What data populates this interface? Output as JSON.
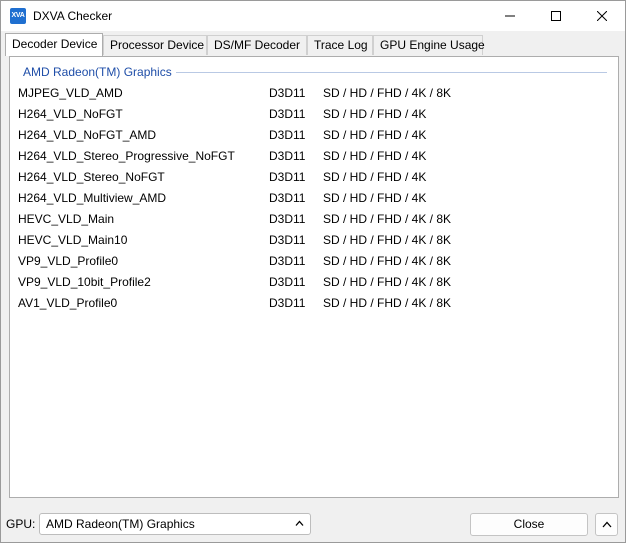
{
  "window": {
    "icon_text": "XVA",
    "title": "DXVA Checker"
  },
  "tabs": [
    {
      "label": "Decoder Device",
      "active": true
    },
    {
      "label": "Processor Device",
      "active": false
    },
    {
      "label": "DS/MF Decoder",
      "active": false
    },
    {
      "label": "Trace Log",
      "active": false
    },
    {
      "label": "GPU Engine Usage",
      "active": false
    }
  ],
  "group": {
    "title": "AMD Radeon(TM) Graphics",
    "rows": [
      {
        "name": "MJPEG_VLD_AMD",
        "api": "D3D11",
        "res": "SD / HD / FHD / 4K / 8K"
      },
      {
        "name": "H264_VLD_NoFGT",
        "api": "D3D11",
        "res": "SD / HD / FHD / 4K"
      },
      {
        "name": "H264_VLD_NoFGT_AMD",
        "api": "D3D11",
        "res": "SD / HD / FHD / 4K"
      },
      {
        "name": "H264_VLD_Stereo_Progressive_NoFGT",
        "api": "D3D11",
        "res": "SD / HD / FHD / 4K"
      },
      {
        "name": "H264_VLD_Stereo_NoFGT",
        "api": "D3D11",
        "res": "SD / HD / FHD / 4K"
      },
      {
        "name": "H264_VLD_Multiview_AMD",
        "api": "D3D11",
        "res": "SD / HD / FHD / 4K"
      },
      {
        "name": "HEVC_VLD_Main",
        "api": "D3D11",
        "res": "SD / HD / FHD / 4K / 8K"
      },
      {
        "name": "HEVC_VLD_Main10",
        "api": "D3D11",
        "res": "SD / HD / FHD / 4K / 8K"
      },
      {
        "name": "VP9_VLD_Profile0",
        "api": "D3D11",
        "res": "SD / HD / FHD / 4K / 8K"
      },
      {
        "name": "VP9_VLD_10bit_Profile2",
        "api": "D3D11",
        "res": "SD / HD / FHD / 4K / 8K"
      },
      {
        "name": "AV1_VLD_Profile0",
        "api": "D3D11",
        "res": "SD / HD / FHD / 4K / 8K"
      }
    ]
  },
  "footer": {
    "gpu_label": "GPU:",
    "gpu_selected": "AMD Radeon(TM) Graphics",
    "close_label": "Close"
  },
  "colors": {
    "group_title": "#1f4ea8",
    "app_icon": "#1f6fd0"
  },
  "icons": {
    "minimize": "minimize-icon",
    "maximize": "maximize-icon",
    "close": "close-icon",
    "select": "chevron-up-icon",
    "expand": "chevron-up-icon"
  }
}
